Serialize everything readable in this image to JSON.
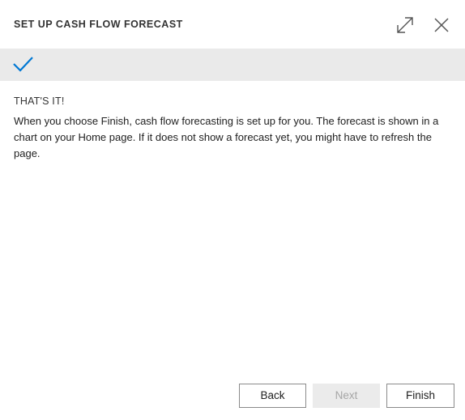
{
  "dialog": {
    "title": "SET UP CASH FLOW FORECAST",
    "expand_icon": "expand-icon",
    "close_icon": "close-icon"
  },
  "step": {
    "icon": "checkmark-icon",
    "accent_color": "#0078d4"
  },
  "content": {
    "heading": "THAT'S IT!",
    "body": "When you choose Finish, cash flow forecasting is set up for you. The forecast is shown in a chart on your Home page. If it does not show a forecast yet, you might have to refresh the page."
  },
  "footer": {
    "back_label": "Back",
    "next_label": "Next",
    "next_disabled": true,
    "finish_label": "Finish"
  }
}
